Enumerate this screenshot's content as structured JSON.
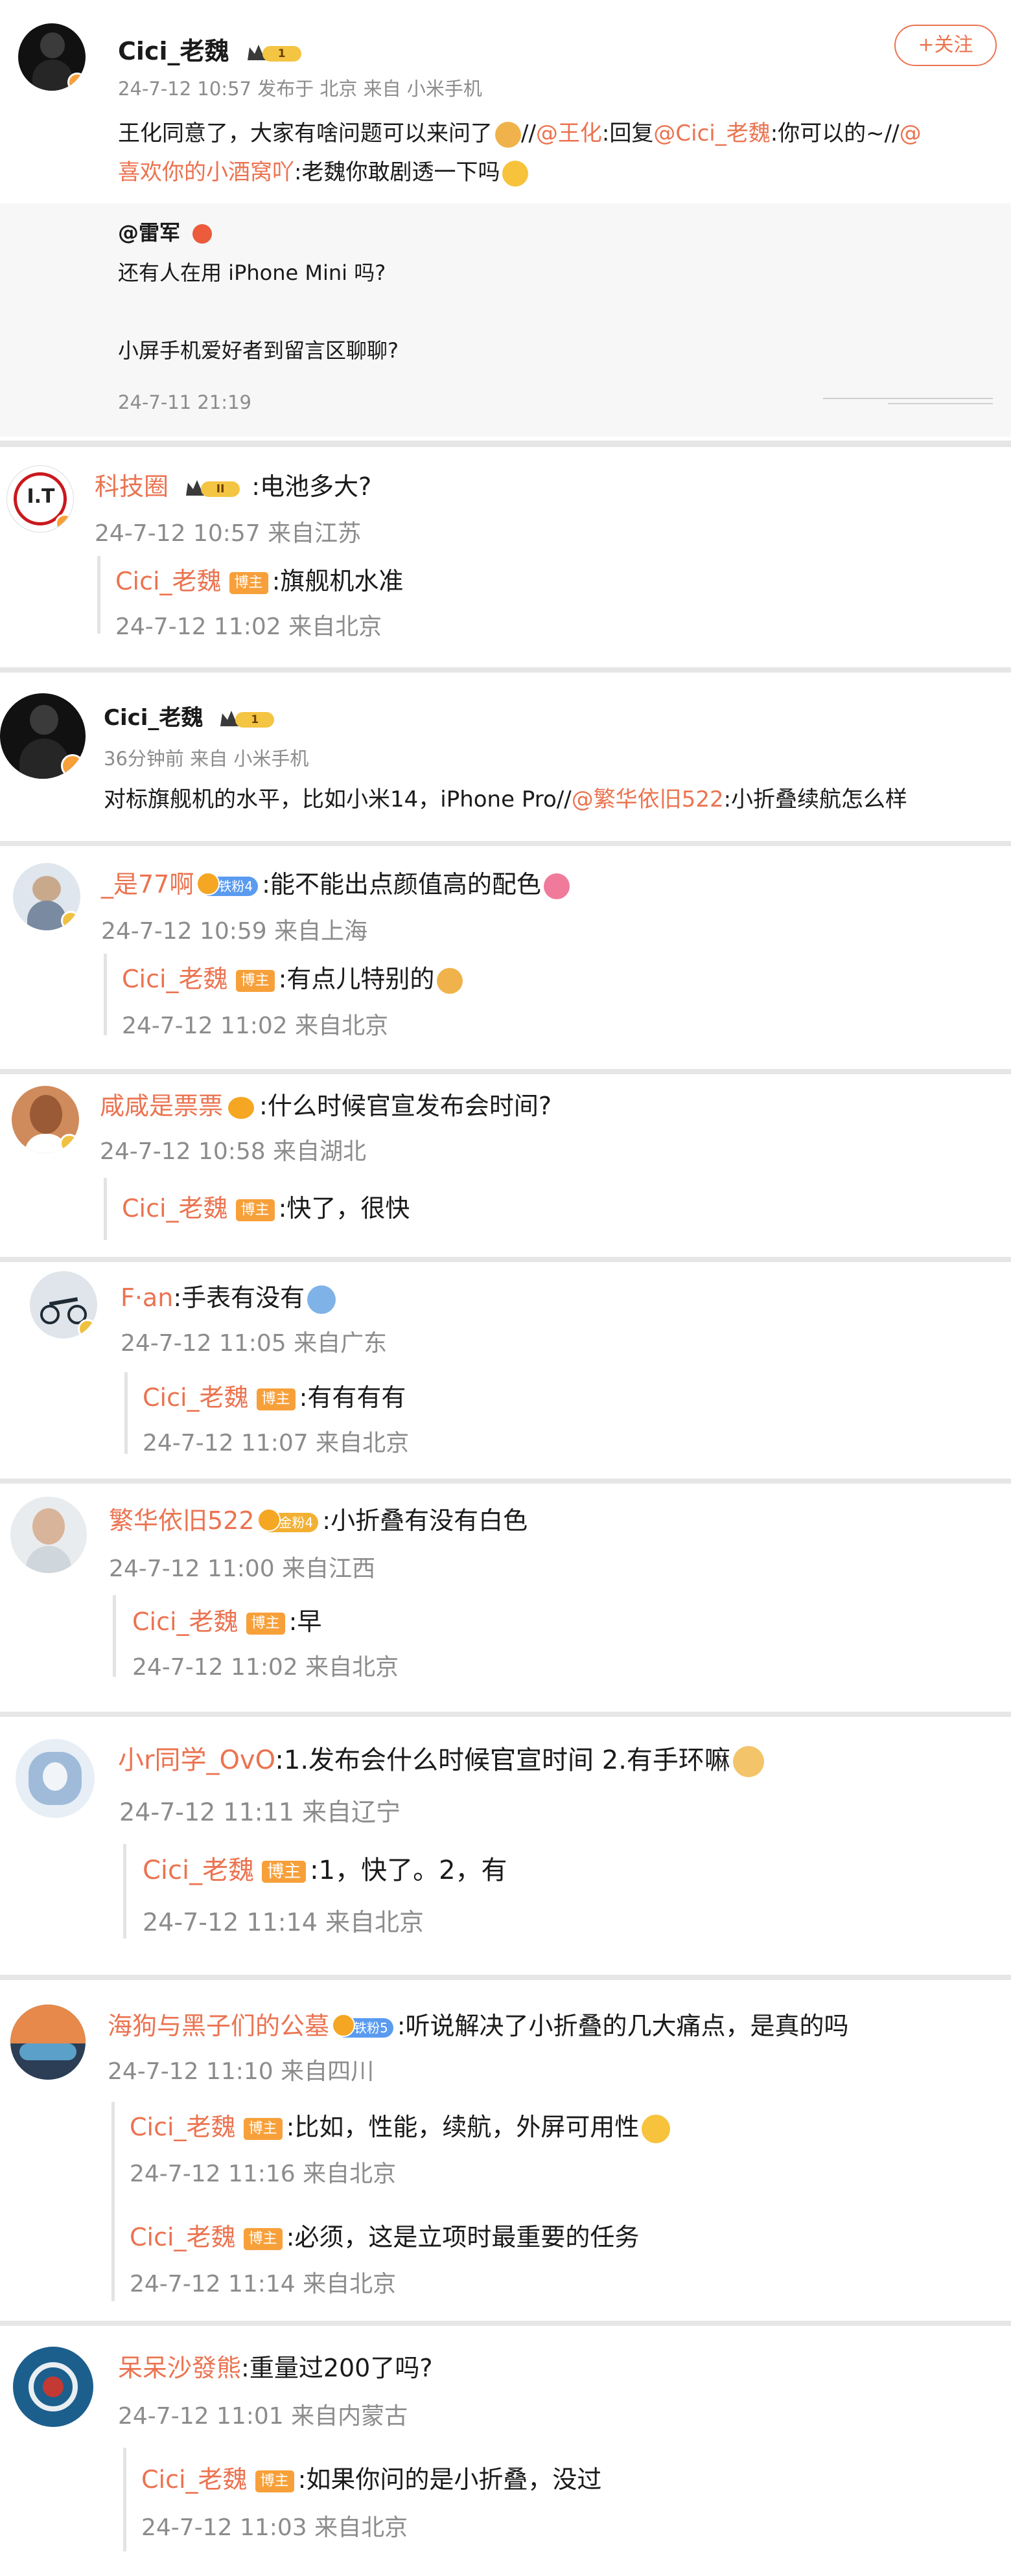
{
  "post": {
    "author": "Cici_老魏",
    "level": "1",
    "meta": "24-7-12 10:57  发布于 北京  来自 小米手机",
    "follow_label": "+关注",
    "text1": "王化同意了，大家有啥问题可以来问了",
    "text2": "//",
    "mention1": "@王化",
    "text3": ":回复",
    "mention2": "@Cici_老魏",
    "text4": ":你可以的~//",
    "mention3": "@",
    "mention3b": "喜欢你的小酒窝吖",
    "text5": ":老魏你敢剧透一下吗",
    "quote": {
      "author": "@雷军",
      "line1": "还有人在用 iPhone Mini 吗?",
      "line2": "小屏手机爱好者到留言区聊聊?",
      "time": "24-7-11 21:19"
    }
  },
  "comments": [
    {
      "user": "科技圈",
      "level": "II",
      "avatar_text": "I.T",
      "text": ":电池多大?",
      "meta": "24-7-12 10:57 来自江苏",
      "replies": [
        {
          "user": "Cici_老魏",
          "badge": "博主",
          "text": ":旗舰机水准",
          "meta": "24-7-12 11:02 来自北京"
        }
      ]
    },
    {
      "user": "Cici_老魏",
      "level": "1",
      "meta": "36分钟前 来自 小米手机",
      "text_pre": "对标旗舰机的水平，比如小米14，iPhone Pro//",
      "mention": "@繁华依旧522",
      "text_post": ":小折叠续航怎么样"
    },
    {
      "user": "_是77啊",
      "fan": "铁粉4",
      "text": ":能不能出点颜值高的配色",
      "meta": "24-7-12 10:59 来自上海",
      "replies": [
        {
          "user": "Cici_老魏",
          "badge": "博主",
          "text": ":有点儿特别的",
          "meta": "24-7-12 11:02 来自北京"
        }
      ]
    },
    {
      "user": "咸咸是票票",
      "text": ":什么时候官宣发布会时间?",
      "meta": "24-7-12 10:58 来自湖北",
      "replies": [
        {
          "user": "Cici_老魏",
          "badge": "博主",
          "text": ":快了，很快"
        }
      ]
    },
    {
      "user": "F·an",
      "text": ":手表有没有",
      "meta": "24-7-12 11:05 来自广东",
      "replies": [
        {
          "user": "Cici_老魏",
          "badge": "博主",
          "text": ":有有有有",
          "meta": "24-7-12 11:07 来自北京"
        }
      ]
    },
    {
      "user": "繁华依旧522",
      "fan": "金粉4",
      "text": ":小折叠有没有白色",
      "meta": "24-7-12 11:00 来自江西",
      "replies": [
        {
          "user": "Cici_老魏",
          "badge": "博主",
          "text": ":早",
          "meta": "24-7-12 11:02 来自北京"
        }
      ]
    },
    {
      "user": "小r同学_OvO",
      "text": ":1.发布会什么时候官宣时间 2.有手环嘛",
      "meta": "24-7-12 11:11 来自辽宁",
      "replies": [
        {
          "user": "Cici_老魏",
          "badge": "博主",
          "text": ":1，快了。2，有",
          "meta": "24-7-12 11:14 来自北京"
        }
      ]
    },
    {
      "user": "海狗与黑子们的公墓",
      "fan": "铁粉5",
      "text": ":听说解决了小折叠的几大痛点，是真的吗",
      "meta": "24-7-12 11:10 来自四川",
      "replies": [
        {
          "user": "Cici_老魏",
          "badge": "博主",
          "text": ":比如，性能，续航，外屏可用性",
          "meta": "24-7-12 11:16 来自北京"
        },
        {
          "user": "Cici_老魏",
          "badge": "博主",
          "text": ":必须，这是立项时最重要的任务",
          "meta": "24-7-12 11:14 来自北京"
        }
      ]
    },
    {
      "user": "呆呆沙發熊",
      "text": ":重量过200了吗?",
      "meta": "24-7-12 11:01 来自内蒙古",
      "replies": [
        {
          "user": "Cici_老魏",
          "badge": "博主",
          "text": ":如果你问的是小折叠，没过",
          "meta": "24-7-12 11:03 来自北京"
        }
      ]
    }
  ],
  "colors": {
    "accent": "#eb7350",
    "meta": "#8c8c8c",
    "verified": "#f7a03a",
    "divider": "#e6e6e6"
  }
}
